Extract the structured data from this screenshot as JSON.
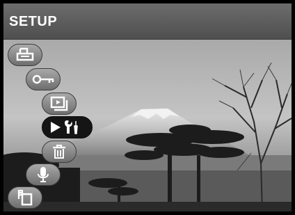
{
  "header": {
    "title": "SETUP"
  },
  "menu": {
    "items": [
      {
        "id": "print",
        "icon": "print-icon"
      },
      {
        "id": "protect",
        "icon": "key-icon"
      },
      {
        "id": "slideshow",
        "icon": "slideshow-icon"
      },
      {
        "id": "playback-setup",
        "icon": "play-setup-icon",
        "selected": true
      },
      {
        "id": "delete",
        "icon": "trash-icon"
      },
      {
        "id": "voice-memo",
        "icon": "microphone-icon"
      },
      {
        "id": "copy",
        "icon": "copy-icon"
      }
    ]
  },
  "colors": {
    "title_bar": "#5e5e5e",
    "menu_item": "#8c8c8c",
    "menu_selected": "#151515"
  }
}
